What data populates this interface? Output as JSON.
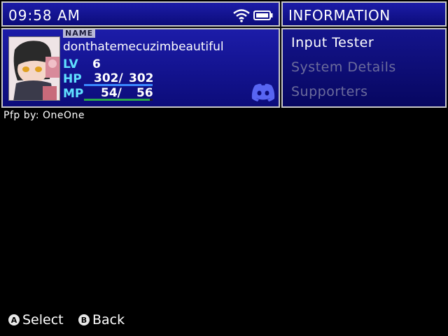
{
  "status_bar": {
    "time": "09:58 AM",
    "wifi_icon": "wifi-icon",
    "battery_icon": "battery-icon"
  },
  "header": {
    "title": "INFORMATION"
  },
  "profile": {
    "name_label": "NAME",
    "username": "donthatemecuzimbeautiful",
    "lv_label": "LV",
    "lv_value": "6",
    "hp_label": "HP",
    "hp_current": "302/",
    "hp_max": "302",
    "hp_fraction": 1.0,
    "hp_color": "#3a88ff",
    "mp_label": "MP",
    "mp_current": "54/",
    "mp_max": "56",
    "mp_fraction": 0.964,
    "mp_color": "#2aa84a",
    "discord_icon": "discord-icon"
  },
  "menu": {
    "items": [
      {
        "label": "Input Tester",
        "enabled": true
      },
      {
        "label": "System Details",
        "enabled": false
      },
      {
        "label": "Supporters",
        "enabled": false
      }
    ]
  },
  "credit": "Pfp by: OneOne",
  "footer": {
    "a_glyph": "A",
    "a_label": "Select",
    "b_glyph": "B",
    "b_label": "Back"
  }
}
